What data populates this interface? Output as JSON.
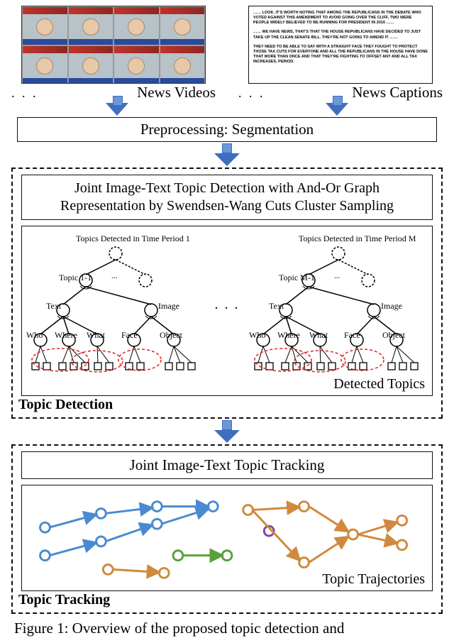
{
  "inputs": {
    "videos_label": "News Videos",
    "captions_label": "News Captions",
    "ellipsis": ". . .",
    "caption_text": {
      "p1": "…… Look, it's worth noting that among the Republicans in the debate who voted against this amendment to avoid going over the cliff, two were people widely believed to be running for President in 2016 ……",
      "p2": "…… We have news, that's that the House Republicans have decided to just take up the clean Senate bill. They're not going to amend it. ……",
      "p3": "They need to be able to say with a straight face they fought to protect those tax cuts for everyone and all the Republicans in the House have done that more than once and that they're fighting to offset any and all tax increases, period."
    }
  },
  "preprocessing": {
    "label": "Preprocessing: Segmentation"
  },
  "detection": {
    "panel_title": "Topic Detection",
    "method_line1": "Joint Image-Text Topic Detection with And-Or Graph",
    "method_line2": "Representation by Swendsen-Wang Cuts Cluster Sampling",
    "tree_left": {
      "root": "Topics Detected in Time Period 1",
      "topic": "Topic 1-1",
      "text": "Text",
      "image": "Image",
      "who": "Who",
      "where": "Where",
      "what": "What",
      "face": "Face",
      "object": "Object"
    },
    "tree_right": {
      "root": "Topics Detected in Time Period M",
      "topic": "Topic M-1",
      "text": "Text",
      "image": "Image",
      "who": "Who",
      "where": "Where",
      "what": "What",
      "face": "Face",
      "object": "Object"
    },
    "detected_label": "Detected Topics",
    "center_dots": ". . ."
  },
  "tracking": {
    "panel_title": "Topic Tracking",
    "method": "Joint Image-Text Topic Tracking",
    "trajectories_label": "Topic Trajectories"
  },
  "figure_caption": "Figure 1: Overview of the proposed topic detection and"
}
